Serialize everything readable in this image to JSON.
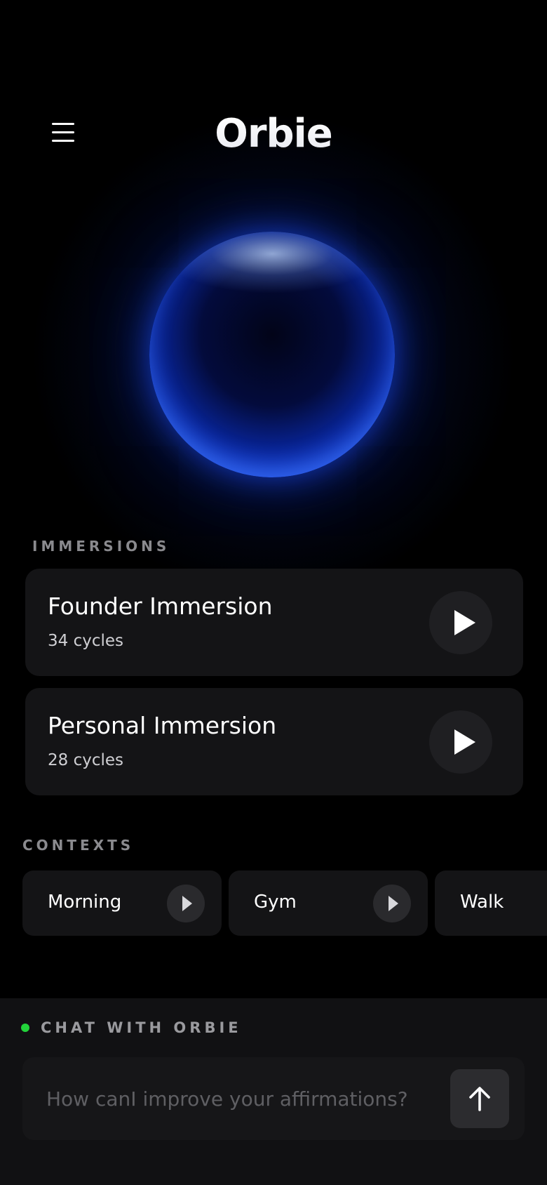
{
  "header": {
    "title": "Orbie",
    "menu_icon": "hamburger-menu-icon"
  },
  "orb": {
    "color": "#1c4dff",
    "glow_color": "#1946e6"
  },
  "immersions": {
    "section_label": "IMMERSIONS",
    "items": [
      {
        "title": "Founder Immersion",
        "subtitle": "34 cycles",
        "icon": "play-icon"
      },
      {
        "title": "Personal Immersion",
        "subtitle": "28 cycles",
        "icon": "play-icon"
      }
    ]
  },
  "contexts": {
    "section_label": "CONTEXTS",
    "items": [
      {
        "label": "Morning",
        "icon": "play-icon"
      },
      {
        "label": "Gym",
        "icon": "play-icon"
      },
      {
        "label": "Walk",
        "icon": "play-icon"
      }
    ]
  },
  "chat": {
    "label": "CHAT WITH ORBIE",
    "status_color": "#22d33a",
    "placeholder": "How canI improve your affirmations?",
    "value": "",
    "send_icon": "arrow-up-icon"
  },
  "colors": {
    "background": "#000000",
    "card": "#141416",
    "panel": "#111113"
  }
}
